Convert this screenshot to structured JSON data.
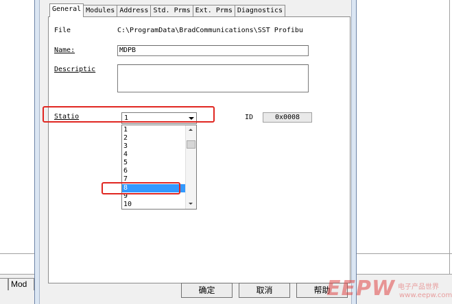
{
  "background": {
    "left_tab_fragment": "",
    "right_tab_fragment": "Mod"
  },
  "dialog": {
    "tabs": [
      {
        "label": "General"
      },
      {
        "label": "Modules"
      },
      {
        "label": "Address"
      },
      {
        "label": "Std. Prms"
      },
      {
        "label": "Ext. Prms"
      },
      {
        "label": "Diagnostics"
      }
    ],
    "active_tab": "General",
    "general": {
      "file_label": "File",
      "file_value": "C:\\ProgramData\\BradCommunications\\SST Profibu",
      "name_label": "Name:",
      "name_value": "MDPB",
      "description_label": "Descriptic",
      "description_value": "",
      "station_label": "Statio",
      "station_value": "1",
      "id_label": "ID",
      "id_value": "0x0008",
      "station_options": [
        "1",
        "2",
        "3",
        "4",
        "5",
        "6",
        "7",
        "8",
        "9",
        "10"
      ],
      "selected_option": "8"
    },
    "buttons": {
      "ok": "确定",
      "cancel": "取消",
      "help": "帮助"
    }
  },
  "colors": {
    "highlight_outline": "#e0251f",
    "selection": "#3399ff"
  },
  "watermark": {
    "logo": "EEPW",
    "tagline": "电子产品世界",
    "url": "www.eepw.com.cn"
  }
}
